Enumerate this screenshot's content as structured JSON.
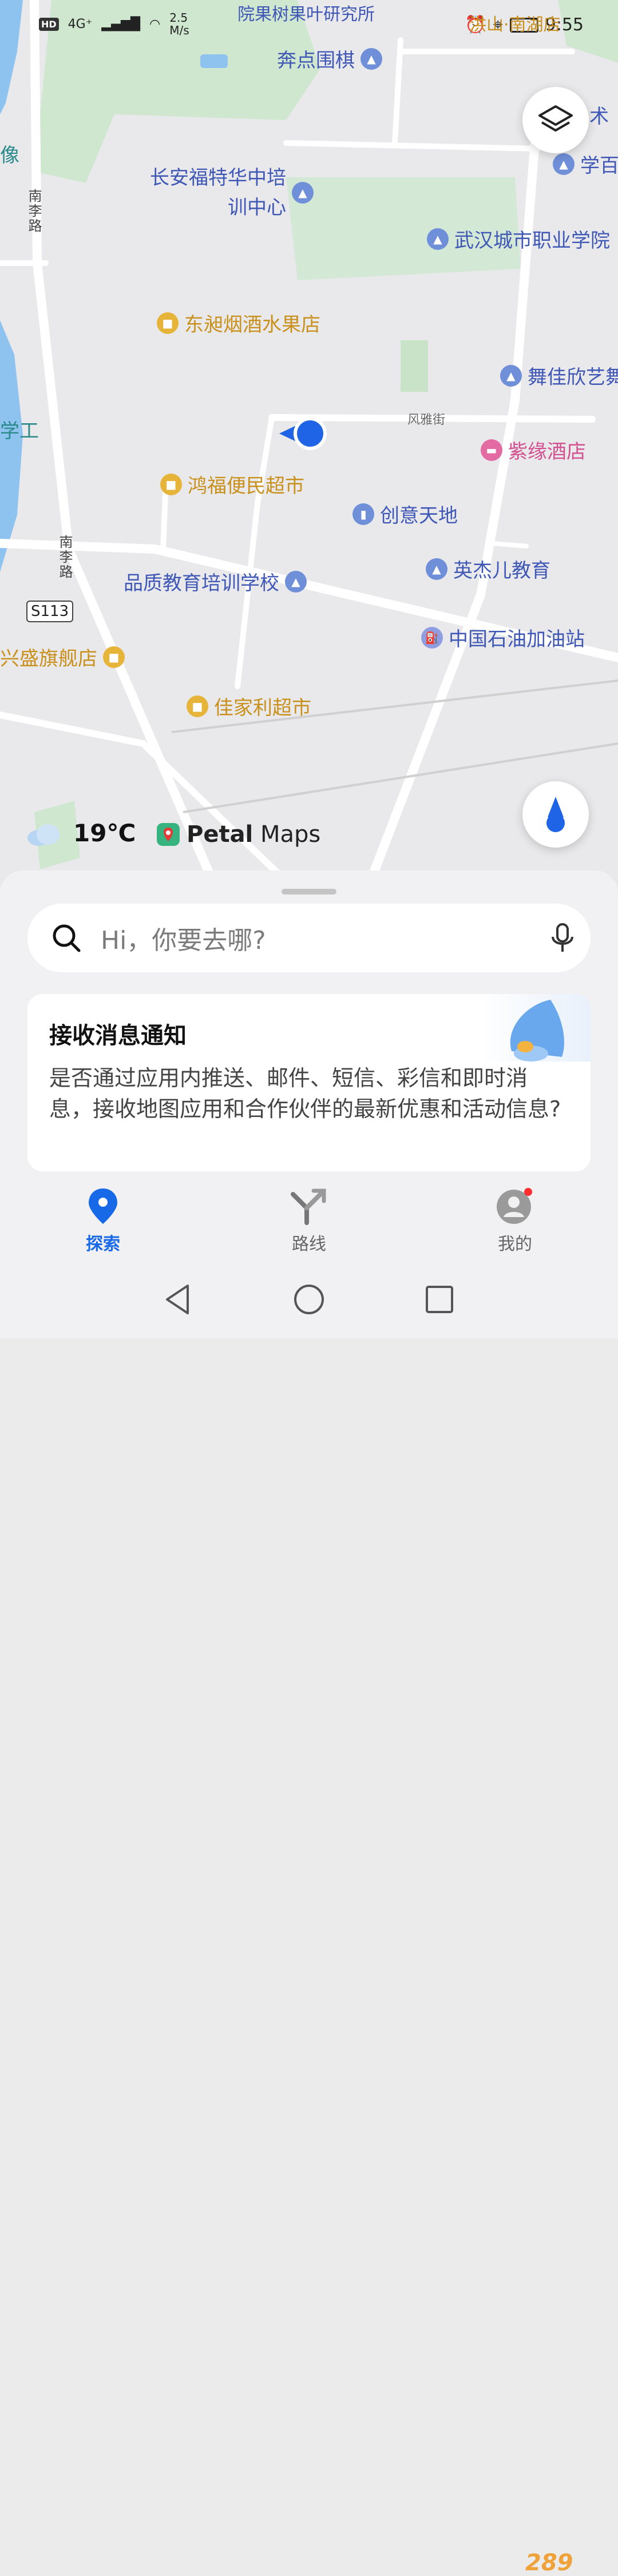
{
  "status_bar": {
    "hd": "HD",
    "network": "4G⁺",
    "speed": "2.5\nM/s",
    "time": "9:55"
  },
  "map": {
    "pois": [
      {
        "name": "奔点围棋",
        "kind": "edu"
      },
      {
        "name": "长安福特华中培\n训中心",
        "kind": "edu"
      },
      {
        "name": "武汉城市职业学院",
        "kind": "edu"
      },
      {
        "name": "东昶烟酒水果店",
        "kind": "shop"
      },
      {
        "name": "舞佳欣艺舞",
        "kind": "edu"
      },
      {
        "name": "紫缘酒店",
        "kind": "hotel"
      },
      {
        "name": "鸿福便民超市",
        "kind": "shop"
      },
      {
        "name": "创意天地",
        "kind": "edu"
      },
      {
        "name": "英杰儿教育",
        "kind": "edu"
      },
      {
        "name": "品质教育培训学校",
        "kind": "edu"
      },
      {
        "name": "中国石油加油站",
        "kind": "gas"
      },
      {
        "name": "兴盛旗舰店",
        "kind": "shop"
      },
      {
        "name": "佳家利超市",
        "kind": "shop"
      },
      {
        "name": "学百",
        "kind": "edu"
      },
      {
        "name": "术",
        "kind": "edu"
      }
    ],
    "top_partial_label": "院果树果叶研究所",
    "top_partial_label_right": "洪山·南湖店",
    "edge_labels": [
      "像",
      "学工"
    ],
    "road_names": {
      "nanli_top": "南李路",
      "nanli_bottom": "南李路",
      "fengya": "风雅街"
    },
    "route_shield": "S113",
    "weather": {
      "temp": "19℃"
    },
    "brand": {
      "bold": "Petal",
      "light": " Maps"
    }
  },
  "sheet": {
    "search_placeholder": "Hi，你要去哪?",
    "card": {
      "title": "接收消息通知",
      "body": "是否通过应用内推送、邮件、短信、彩信和即时消息，接收地图应用和合作伙伴的最新优惠和活动信息?"
    }
  },
  "tabs": [
    {
      "label": "探索",
      "icon": "location-pin-icon"
    },
    {
      "label": "路线",
      "icon": "route-icon"
    },
    {
      "label": "我的",
      "icon": "profile-icon"
    }
  ],
  "watermark": "289"
}
